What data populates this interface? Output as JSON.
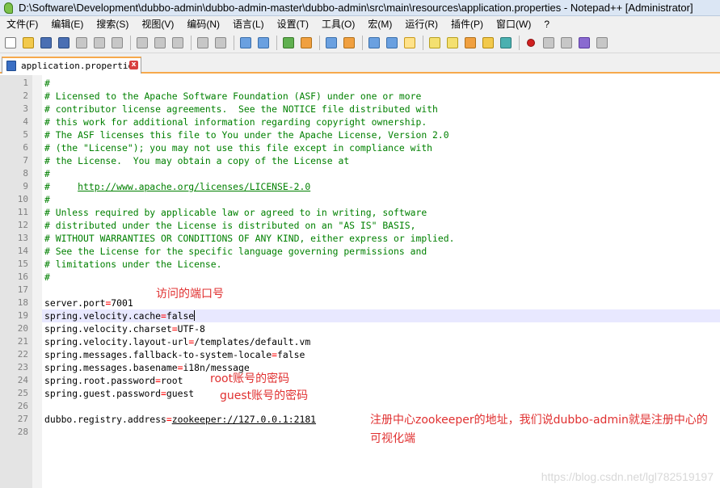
{
  "window": {
    "title": "D:\\Software\\Development\\dubbo-admin\\dubbo-admin-master\\dubbo-admin\\src\\main\\resources\\application.properties - Notepad++ [Administrator]"
  },
  "menu": [
    "文件(F)",
    "编辑(E)",
    "搜索(S)",
    "视图(V)",
    "编码(N)",
    "语言(L)",
    "设置(T)",
    "工具(O)",
    "宏(M)",
    "运行(R)",
    "插件(P)",
    "窗口(W)",
    "?"
  ],
  "toolbar": {
    "buttons": [
      "new-icon",
      "open-icon",
      "save-icon",
      "save-all-icon",
      "close-icon",
      "close-all-icon",
      "print-icon",
      "cut-icon",
      "copy-icon",
      "paste-icon",
      "undo-icon",
      "redo-icon",
      "find-icon",
      "replace-icon",
      "zoom-in-icon",
      "zoom-out-icon",
      "sync-vertical-icon",
      "sync-horizontal-icon",
      "word-wrap-icon",
      "show-all-chars-icon",
      "indent-guide-icon",
      "language-icon",
      "doc-map-icon",
      "function-list-icon",
      "folder-workspace-icon",
      "monitor-icon",
      "record-macro-icon",
      "stop-record-icon",
      "play-macro-icon",
      "run-macro-multiple-icon",
      "save-macro-icon"
    ]
  },
  "tab": {
    "label": "application.properties",
    "close": "x"
  },
  "editor": {
    "current_line": 19,
    "lines": [
      {
        "n": "1",
        "type": "comment",
        "text": "#"
      },
      {
        "n": "2",
        "type": "comment",
        "text": "# Licensed to the Apache Software Foundation (ASF) under one or more"
      },
      {
        "n": "3",
        "type": "comment",
        "text": "# contributor license agreements.  See the NOTICE file distributed with"
      },
      {
        "n": "4",
        "type": "comment",
        "text": "# this work for additional information regarding copyright ownership."
      },
      {
        "n": "5",
        "type": "comment",
        "text": "# The ASF licenses this file to You under the Apache License, Version 2.0"
      },
      {
        "n": "6",
        "type": "comment",
        "text": "# (the \"License\"); you may not use this file except in compliance with"
      },
      {
        "n": "7",
        "type": "comment",
        "text": "# the License.  You may obtain a copy of the License at"
      },
      {
        "n": "8",
        "type": "comment",
        "text": "#"
      },
      {
        "n": "9",
        "type": "comment-link",
        "prefix": "#     ",
        "link": "http://www.apache.org/licenses/LICENSE-2.0"
      },
      {
        "n": "10",
        "type": "comment",
        "text": "#"
      },
      {
        "n": "11",
        "type": "comment",
        "text": "# Unless required by applicable law or agreed to in writing, software"
      },
      {
        "n": "12",
        "type": "comment",
        "text": "# distributed under the License is distributed on an \"AS IS\" BASIS,"
      },
      {
        "n": "13",
        "type": "comment",
        "text": "# WITHOUT WARRANTIES OR CONDITIONS OF ANY KIND, either express or implied."
      },
      {
        "n": "14",
        "type": "comment",
        "text": "# See the License for the specific language governing permissions and"
      },
      {
        "n": "15",
        "type": "comment",
        "text": "# limitations under the License."
      },
      {
        "n": "16",
        "type": "comment",
        "text": "#"
      },
      {
        "n": "17",
        "type": "blank",
        "text": ""
      },
      {
        "n": "18",
        "type": "prop",
        "key": "server.port",
        "value": "7001"
      },
      {
        "n": "19",
        "type": "prop",
        "key": "spring.velocity.cache",
        "value": "false"
      },
      {
        "n": "20",
        "type": "prop",
        "key": "spring.velocity.charset",
        "value": "UTF-8"
      },
      {
        "n": "21",
        "type": "prop",
        "key": "spring.velocity.layout-url",
        "value": "/templates/default.vm"
      },
      {
        "n": "22",
        "type": "prop",
        "key": "spring.messages.fallback-to-system-locale",
        "value": "false"
      },
      {
        "n": "23",
        "type": "prop",
        "key": "spring.messages.basename",
        "value": "i18n/message"
      },
      {
        "n": "24",
        "type": "prop",
        "key": "spring.root.password",
        "value": "root"
      },
      {
        "n": "25",
        "type": "prop",
        "key": "spring.guest.password",
        "value": "guest"
      },
      {
        "n": "26",
        "type": "blank",
        "text": ""
      },
      {
        "n": "27",
        "type": "prop-link",
        "key": "dubbo.registry.address",
        "value": "zookeeper://127.0.0.1:2181"
      },
      {
        "n": "28",
        "type": "blank",
        "text": ""
      }
    ]
  },
  "annotations": {
    "port": "访问的端口号",
    "root": "root账号的密码",
    "guest": "guest账号的密码",
    "registry": "注册中心zookeeper的地址，我们说dubbo-admin就是注册中心的可视化端"
  },
  "watermark": "https://blog.csdn.net/lgl782519197",
  "colors": {
    "comment": "#008000",
    "operator": "#ff0000",
    "annotation": "#e03030",
    "tab_accent": "#f6a94c",
    "current_line": "#e8e8ff"
  }
}
